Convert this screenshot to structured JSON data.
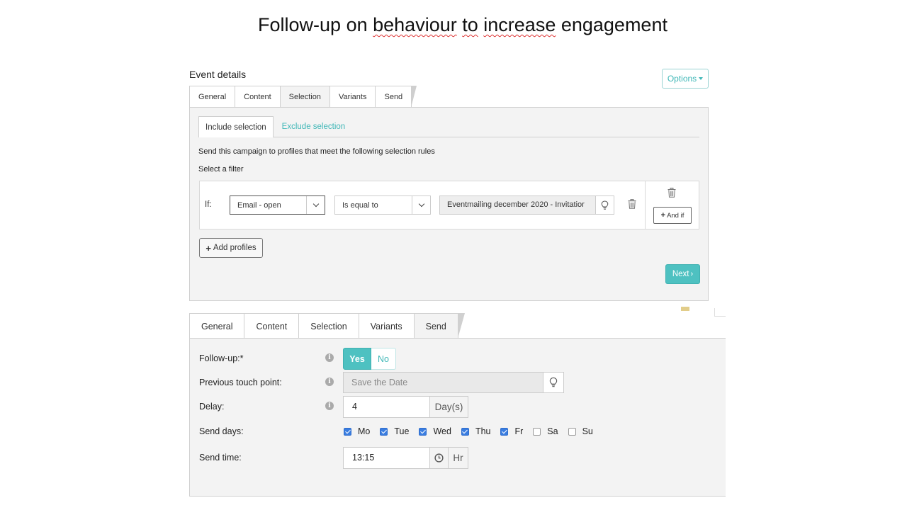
{
  "slide": {
    "title_parts": [
      "Follow-up on ",
      "behaviour",
      " ",
      "to",
      " ",
      "increase",
      " engagement"
    ]
  },
  "event_details": {
    "heading": "Event details",
    "options_label": "Options",
    "tabs": [
      {
        "label": "General",
        "active": false
      },
      {
        "label": "Content",
        "active": false
      },
      {
        "label": "Selection",
        "active": true
      },
      {
        "label": "Variants",
        "active": false
      },
      {
        "label": "Send",
        "active": false
      }
    ],
    "subtabs": {
      "include": "Include selection",
      "exclude": "Exclude selection"
    },
    "description": "Send this campaign to profiles that meet the following selection rules",
    "filter_label": "Select a filter",
    "rule": {
      "if_label": "If:",
      "field": "Email - open",
      "operator": "Is equal to",
      "value": "Eventmailing december 2020 - Invitatior"
    },
    "and_if_label": "And if",
    "add_profiles_label": "Add profiles",
    "next_label": "Next"
  },
  "send_panel": {
    "tabs": [
      {
        "label": "General",
        "active": false
      },
      {
        "label": "Content",
        "active": false
      },
      {
        "label": "Selection",
        "active": false
      },
      {
        "label": "Variants",
        "active": false
      },
      {
        "label": "Send",
        "active": true
      }
    ],
    "followup": {
      "label": "Follow-up:*",
      "yes": "Yes",
      "no": "No",
      "selected": "Yes"
    },
    "touch_point": {
      "label": "Previous touch point:",
      "placeholder": "Save the Date"
    },
    "delay": {
      "label": "Delay:",
      "value": "4",
      "unit": "Day(s)"
    },
    "send_days": {
      "label": "Send days:",
      "days": [
        {
          "label": "Mo",
          "checked": true
        },
        {
          "label": "Tue",
          "checked": true
        },
        {
          "label": "Wed",
          "checked": true
        },
        {
          "label": "Thu",
          "checked": true
        },
        {
          "label": "Fr",
          "checked": true
        },
        {
          "label": "Sa",
          "checked": false
        },
        {
          "label": "Su",
          "checked": false
        }
      ]
    },
    "send_time": {
      "label": "Send time:",
      "value": "13:15",
      "unit": "Hr"
    }
  },
  "icons": {
    "trash": "trash-icon",
    "bulb": "lightbulb-icon",
    "info": "info-icon",
    "clock": "clock-icon",
    "plus": "plus-icon",
    "chevron": "chevron-down-icon"
  },
  "colors": {
    "accent": "#4ec1c1",
    "accent_text": "#3fb7b7",
    "checkbox": "#3a7de0",
    "panel_bg": "#f3f3f3"
  }
}
